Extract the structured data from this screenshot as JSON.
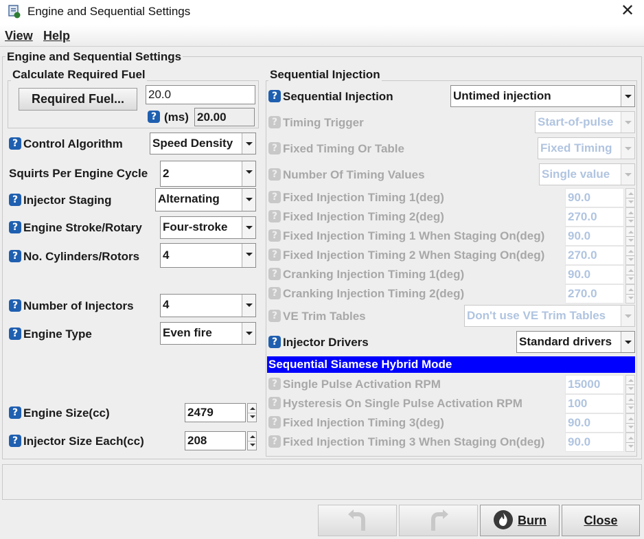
{
  "window": {
    "title": "Engine and Sequential Settings",
    "close_glyph": "✕"
  },
  "menu": [
    {
      "label": "View"
    },
    {
      "label": "Help"
    }
  ],
  "panel_title": "Engine and Sequential Settings",
  "calc": {
    "title": "Calculate Required Fuel",
    "button_label": "Required Fuel...",
    "value": "20.0",
    "ms_label": "(ms)",
    "ms_value": "20.00"
  },
  "left": {
    "control_algorithm": {
      "label": "Control Algorithm",
      "value": "Speed Density"
    },
    "squirts": {
      "label": "Squirts Per Engine Cycle",
      "value": "2"
    },
    "injector_staging": {
      "label": "Injector Staging",
      "value": "Alternating"
    },
    "engine_stroke": {
      "label": "Engine Stroke/Rotary",
      "value": "Four-stroke"
    },
    "cylinders": {
      "label": "No. Cylinders/Rotors",
      "value": "4"
    },
    "injectors": {
      "label": "Number of Injectors",
      "value": "4"
    },
    "engine_type": {
      "label": "Engine Type",
      "value": "Even fire"
    },
    "engine_size": {
      "label": "Engine Size(cc)",
      "value": "2479"
    },
    "injector_size": {
      "label": "Injector Size Each(cc)",
      "value": "208"
    }
  },
  "seq": {
    "title": "Sequential Injection",
    "seq_injection": {
      "label": "Sequential Injection",
      "value": "Untimed injection"
    },
    "timing_trigger": {
      "label": "Timing Trigger",
      "value": "Start-of-pulse"
    },
    "fixed_timing": {
      "label": "Fixed Timing Or Table",
      "value": "Fixed Timing"
    },
    "num_timing": {
      "label": "Number Of Timing Values",
      "value": "Single value"
    },
    "fit1": {
      "label": "Fixed Injection Timing 1(deg)",
      "value": "90.0"
    },
    "fit2": {
      "label": "Fixed Injection Timing 2(deg)",
      "value": "270.0"
    },
    "fit1s": {
      "label": "Fixed Injection Timing 1 When Staging On(deg)",
      "value": "90.0"
    },
    "fit2s": {
      "label": "Fixed Injection Timing 2 When Staging On(deg)",
      "value": "270.0"
    },
    "cit1": {
      "label": "Cranking Injection Timing 1(deg)",
      "value": "90.0"
    },
    "cit2": {
      "label": "Cranking Injection Timing 2(deg)",
      "value": "270.0"
    },
    "ve_trim": {
      "label": "VE Trim Tables",
      "value": "Don't use VE Trim Tables"
    },
    "injector_drivers": {
      "label": "Injector Drivers",
      "value": "Standard drivers"
    },
    "hybrid_title": "Sequential Siamese Hybrid Mode",
    "single_pulse": {
      "label": "Single Pulse Activation RPM",
      "value": "15000"
    },
    "hysteresis": {
      "label": "Hysteresis On Single Pulse Activation RPM",
      "value": "100"
    },
    "fit3": {
      "label": "Fixed Injection Timing 3(deg)",
      "value": "90.0"
    },
    "fit3s": {
      "label": "Fixed Injection Timing 3 When Staging On(deg)",
      "value": "90.0"
    }
  },
  "footer": {
    "burn_label": "Burn",
    "close_label": "Close"
  },
  "icons": {
    "help": "?"
  },
  "colors": {
    "help_blue": "#1f5fb0",
    "hybrid_bar": "#0000ff",
    "disabled_value": "#b0c4e0"
  }
}
